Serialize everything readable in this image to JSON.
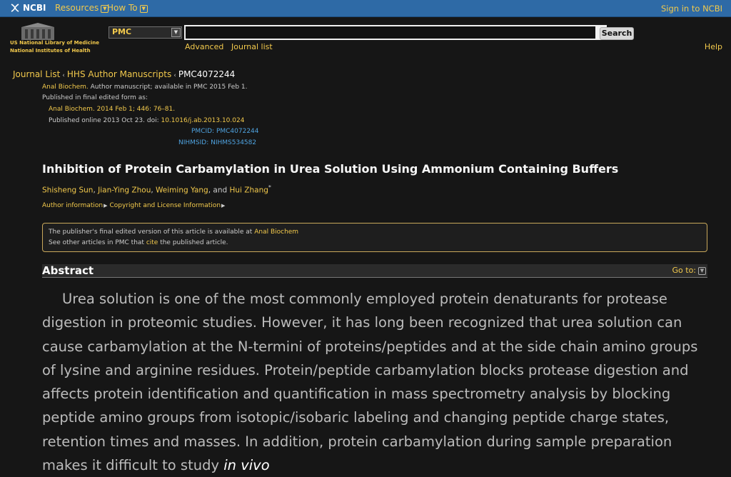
{
  "topbar": {
    "brand": "NCBI",
    "resources": "Resources",
    "howto": "How To",
    "signin": "Sign in to NCBI"
  },
  "header": {
    "logo_line1": "US National Library of Medicine",
    "logo_line2": "National Institutes of Health",
    "db_value": "PMC",
    "search_button": "Search",
    "advanced": "Advanced",
    "journal_list": "Journal list",
    "help": "Help"
  },
  "breadcrumb": {
    "item1": "Journal List",
    "item2": "HHS Author Manuscripts",
    "item3": "PMC4072244"
  },
  "meta": {
    "journal": "Anal Biochem.",
    "availability": "Author manuscript; available in PMC 2015 Feb 1.",
    "published_final": "Published in final edited form as:",
    "citation": "Anal Biochem. 2014 Feb 1; 446: 76–81.",
    "published_online": "Published online 2013 Oct 23. doi: ",
    "doi": "10.1016/j.ab.2013.10.024",
    "pmcid": "PMCID: PMC4072244",
    "nihmsid": "NIHMSID: NIHMS534582"
  },
  "article": {
    "title": "Inhibition of Protein Carbamylation in Urea Solution Using Ammonium Containing Buffers",
    "author1": "Shisheng Sun",
    "author2": "Jian-Ying Zhou",
    "author3": "Weiming Yang",
    "and": ", and ",
    "author4": "Hui Zhang",
    "star": "*",
    "author_info": "Author information",
    "copyright": "Copyright and License Information"
  },
  "notice": {
    "line1_text": "The publisher's final edited version of this article is available at ",
    "line1_link": "Anal Biochem",
    "line2_pre": "See other articles in PMC that ",
    "line2_link": "cite",
    "line2_post": " the published article."
  },
  "abstract": {
    "heading": "Abstract",
    "goto": "Go to:",
    "text": "Urea solution is one of the most commonly employed protein denaturants for protease digestion in proteomic studies. However, it has long been recognized that urea solution can cause carbamylation at the N-termini of proteins/peptides and at the side chain amino groups of lysine and arginine residues. Protein/peptide carbamylation blocks protease digestion and affects protein identification and quantification in mass spectrometry analysis by blocking peptide amino groups from isotopic/isobaric labeling and changing peptide charge states, retention times and masses. In addition, protein carbamylation during sample preparation makes it difficult to study ",
    "italic": "in vivo"
  },
  "colors": {
    "topbar": "#2e6aa6",
    "link": "#f2c94c",
    "background": "#161616",
    "id_blue": "#4fa3e0"
  }
}
